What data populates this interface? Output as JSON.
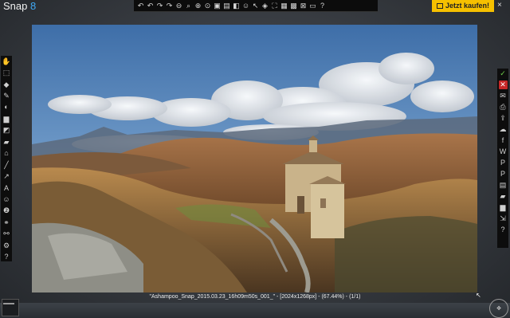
{
  "app": {
    "logo_text": "Snap",
    "logo_version": "8",
    "close_glyph": "×"
  },
  "toolbar_top": {
    "buttons": [
      {
        "name": "rotate-left-icon",
        "glyph": "↶"
      },
      {
        "name": "undo-icon",
        "glyph": "↶"
      },
      {
        "name": "redo-icon",
        "glyph": "↷"
      },
      {
        "name": "rotate-right-icon",
        "glyph": "↷"
      },
      {
        "name": "zoom-out-icon",
        "glyph": "⊖"
      },
      {
        "name": "search-icon",
        "glyph": "⌕"
      },
      {
        "name": "zoom-in-icon",
        "glyph": "⊕"
      },
      {
        "name": "fit-window-icon",
        "glyph": "⊙"
      },
      {
        "name": "image-size-icon",
        "glyph": "▣"
      },
      {
        "name": "crop-icon",
        "glyph": "▤"
      },
      {
        "name": "split-view-icon",
        "glyph": "◧"
      },
      {
        "name": "effects-icon",
        "glyph": "☺"
      },
      {
        "name": "pointer-icon",
        "glyph": "↖"
      },
      {
        "name": "fill-icon",
        "glyph": "◈"
      },
      {
        "name": "stamp-icon",
        "glyph": "⛶"
      },
      {
        "name": "save-icon",
        "glyph": "▦"
      },
      {
        "name": "save-as-icon",
        "glyph": "▩"
      },
      {
        "name": "close-document-icon",
        "glyph": "⊠"
      },
      {
        "name": "frame-icon",
        "glyph": "▭"
      },
      {
        "name": "help-icon",
        "glyph": "?"
      }
    ]
  },
  "buy_button": {
    "label": "Jetzt kaufen!"
  },
  "left_toolbar": {
    "buttons": [
      {
        "name": "hand-tool-icon",
        "glyph": "✋"
      },
      {
        "name": "select-tool-icon",
        "glyph": "⬚"
      },
      {
        "name": "eraser-tool-icon",
        "glyph": "◆"
      },
      {
        "name": "pen-tool-icon",
        "glyph": "✎"
      },
      {
        "name": "blur-tool-icon",
        "glyph": "◐"
      },
      {
        "name": "fill-tool-icon",
        "glyph": "▆"
      },
      {
        "name": "shadow-tool-icon",
        "glyph": "◩"
      },
      {
        "name": "marker-tool-icon",
        "glyph": "▰"
      },
      {
        "name": "stamp-tool-icon",
        "glyph": "⌂"
      },
      {
        "name": "line-tool-icon",
        "glyph": "╱"
      },
      {
        "name": "arrow-tool-icon",
        "glyph": "↗"
      },
      {
        "name": "text-tool-icon",
        "glyph": "A"
      },
      {
        "name": "emoji-tool-icon",
        "glyph": "☺"
      },
      {
        "name": "numbering-tool-icon",
        "glyph": "❷"
      },
      {
        "name": "shapes-tool-icon",
        "glyph": "⚭"
      },
      {
        "name": "link-tool-icon",
        "glyph": "⚯"
      },
      {
        "name": "settings-tool-icon",
        "glyph": "⚙"
      },
      {
        "name": "help-tool-icon",
        "glyph": "?"
      }
    ]
  },
  "right_toolbar": {
    "buttons": [
      {
        "name": "accept-icon",
        "glyph": "✓",
        "style": "green"
      },
      {
        "name": "cancel-icon",
        "glyph": "✕",
        "style": "red"
      },
      {
        "name": "email-icon",
        "glyph": "✉",
        "style": ""
      },
      {
        "name": "print-icon",
        "glyph": "⎙",
        "style": ""
      },
      {
        "name": "upload-icon",
        "glyph": "⇪",
        "style": ""
      },
      {
        "name": "flickr-icon",
        "glyph": "☁",
        "style": ""
      },
      {
        "name": "facebook-icon",
        "glyph": "f",
        "style": ""
      },
      {
        "name": "word-export-icon",
        "glyph": "W",
        "style": ""
      },
      {
        "name": "pdf-export-icon",
        "glyph": "P",
        "style": ""
      },
      {
        "name": "powerpoint-export-icon",
        "glyph": "P",
        "style": ""
      },
      {
        "name": "clipboard-icon",
        "glyph": "▤",
        "style": ""
      },
      {
        "name": "folder-icon",
        "glyph": "▰",
        "style": ""
      },
      {
        "name": "save-file-icon",
        "glyph": "▆",
        "style": ""
      },
      {
        "name": "share-icon",
        "glyph": "⇲",
        "style": ""
      },
      {
        "name": "help-right-icon",
        "glyph": "?",
        "style": ""
      }
    ]
  },
  "status": {
    "file_info": "\"Ashampoo_Snap_2015.03.23_16h09m50s_001_\" - [2024x1268px] - (67.44%) - (1/1)"
  },
  "pan_control": {
    "glyph": "✥"
  },
  "colors": {
    "buy_button_bg": "#f6c000",
    "logo_accent": "#3fa9f5",
    "cancel_red": "#c62828",
    "accept_green": "#6fd14a"
  }
}
